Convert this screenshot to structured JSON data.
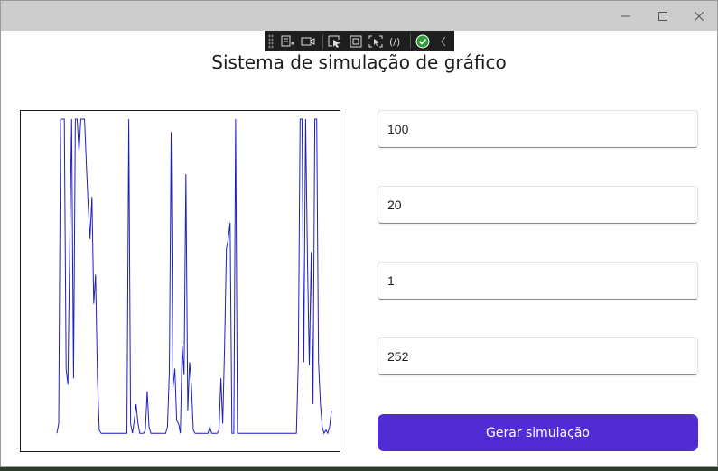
{
  "window": {
    "controls": [
      "minimize",
      "maximize",
      "close"
    ]
  },
  "toolbar": {
    "icons": [
      "grip-icon",
      "live-visual-tree-icon",
      "display-layout-adorners-icon",
      "select-element-icon",
      "show-layout-icon",
      "track-focus-icon",
      "hot-reload-icon",
      "binding-failures-icon",
      "collapse-chevron-icon"
    ]
  },
  "header": {
    "title": "Sistema de simulação de gráfico"
  },
  "form": {
    "field1_value": "100",
    "field2_value": "20",
    "field3_value": "1",
    "field4_value": "252",
    "button_label": "Gerar simulação"
  },
  "colors": {
    "accent": "#512bd4",
    "line": "#1f1fbf",
    "check": "#2e9e3a"
  },
  "chart_data": {
    "type": "line",
    "title": "",
    "xlabel": "",
    "ylabel": "",
    "y_normalized_top_clipped": true,
    "y": [
      0.03,
      0.06,
      1.0,
      1.0,
      1.0,
      0.23,
      0.18,
      0.62,
      1.0,
      0.2,
      1.0,
      1.0,
      0.9,
      1.0,
      1.0,
      1.0,
      0.86,
      0.73,
      0.63,
      0.76,
      0.43,
      0.52,
      0.2,
      0.04,
      0.03,
      0.03,
      0.03,
      0.03,
      0.03,
      0.03,
      0.03,
      0.03,
      0.03,
      0.03,
      0.03,
      0.03,
      0.03,
      0.03,
      0.03,
      1.0,
      0.06,
      0.03,
      0.07,
      0.12,
      0.06,
      0.03,
      0.03,
      0.03,
      0.04,
      0.16,
      0.05,
      0.03,
      0.03,
      0.03,
      0.03,
      0.03,
      0.03,
      0.03,
      0.03,
      0.03,
      0.05,
      0.22,
      0.96,
      0.17,
      0.23,
      0.07,
      0.06,
      0.03,
      0.3,
      0.21,
      0.83,
      0.1,
      0.25,
      0.18,
      0.04,
      0.03,
      0.03,
      0.03,
      0.03,
      0.03,
      0.03,
      0.03,
      0.03,
      0.05,
      0.03,
      0.03,
      0.03,
      0.03,
      0.04,
      0.2,
      0.06,
      0.3,
      0.6,
      0.63,
      0.68,
      0.03,
      0.03,
      1.0,
      0.03,
      0.03,
      0.03,
      0.03,
      0.03,
      0.03,
      0.03,
      0.03,
      0.03,
      0.03,
      0.03,
      0.03,
      0.03,
      0.03,
      0.03,
      0.03,
      0.03,
      0.03,
      0.03,
      0.03,
      0.03,
      0.03,
      0.03,
      0.03,
      0.03,
      0.03,
      0.03,
      0.03,
      0.03,
      0.03,
      0.03,
      0.03,
      0.03,
      0.25,
      1.0,
      1.0,
      0.25,
      1.0,
      0.56,
      0.24,
      0.59,
      0.12,
      1.0,
      1.0,
      0.25,
      0.12,
      0.05,
      0.03,
      0.04,
      0.03,
      0.05,
      0.1
    ]
  }
}
